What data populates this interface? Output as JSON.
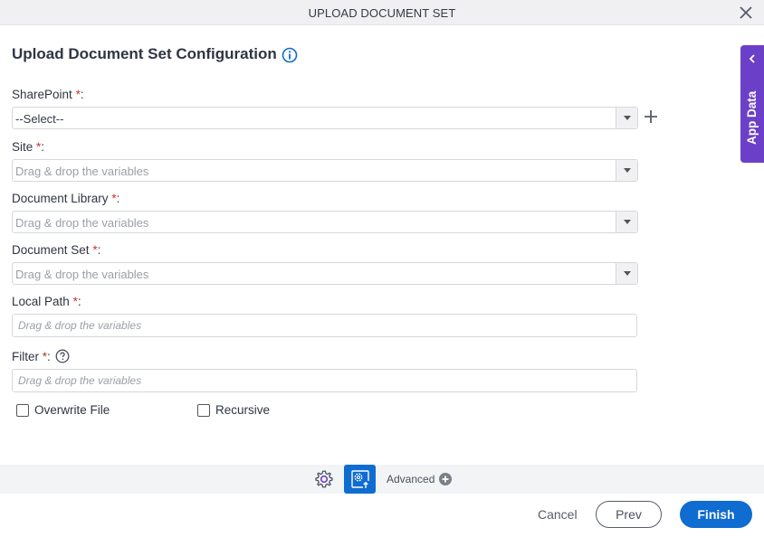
{
  "dialog": {
    "title": "UPLOAD DOCUMENT SET",
    "close_icon": "close-icon"
  },
  "heading": {
    "text": "Upload Document Set Configuration",
    "info_icon": "info-icon"
  },
  "fields": {
    "sharepoint": {
      "label": "SharePoint",
      "required": "*",
      "suffix": ":",
      "value": "--Select--",
      "type": "dropdown"
    },
    "site": {
      "label": "Site",
      "required": "*",
      "suffix": ":",
      "placeholder": "Drag & drop the variables",
      "type": "dropdown"
    },
    "document_library": {
      "label": "Document Library",
      "required": "*",
      "suffix": ":",
      "placeholder": "Drag & drop the variables",
      "type": "dropdown"
    },
    "document_set": {
      "label": "Document Set",
      "required": "*",
      "suffix": ":",
      "placeholder": "Drag & drop the variables",
      "type": "dropdown"
    },
    "local_path": {
      "label": "Local Path",
      "required": "*",
      "suffix": ":",
      "placeholder": "Drag & drop the variables",
      "type": "text"
    },
    "filter": {
      "label": "Filter",
      "required": "*",
      "suffix": ":",
      "placeholder": "Drag & drop the variables",
      "type": "text",
      "help_icon": "help-icon"
    }
  },
  "checkboxes": {
    "overwrite_file": {
      "label": "Overwrite File",
      "checked": false
    },
    "recursive": {
      "label": "Recursive",
      "checked": false
    }
  },
  "side_panel": {
    "label": "App Data"
  },
  "bottom_toolbar": {
    "advanced_label": "Advanced"
  },
  "footer": {
    "cancel_label": "Cancel",
    "prev_label": "Prev",
    "finish_label": "Finish"
  },
  "colors": {
    "accent": "#0f6cd0",
    "side_panel": "#6c3fc9",
    "required": "#c0392b"
  }
}
